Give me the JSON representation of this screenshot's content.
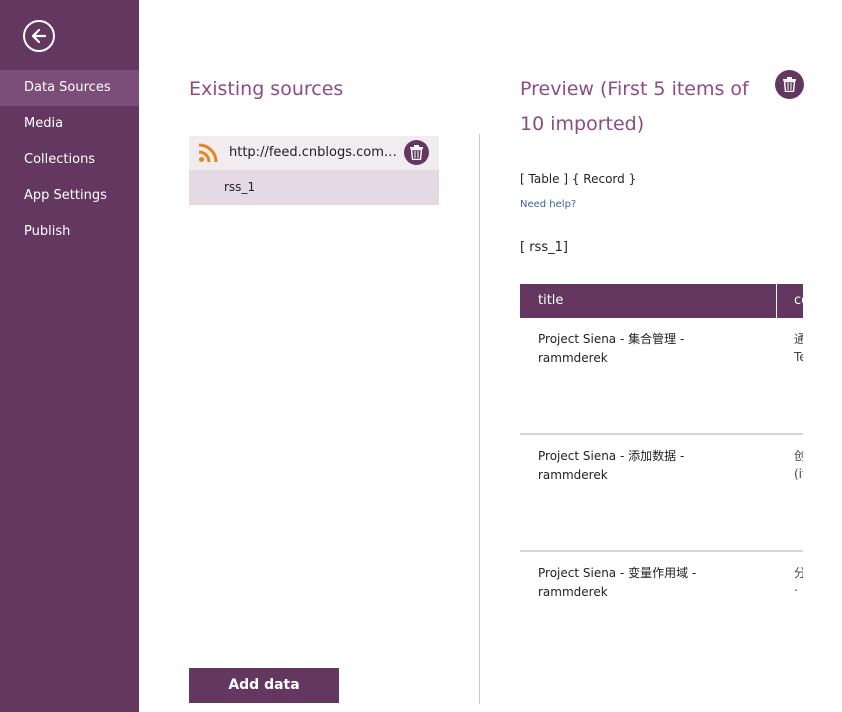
{
  "nav": {
    "items": [
      {
        "label": "Data Sources",
        "active": true
      },
      {
        "label": "Media",
        "active": false
      },
      {
        "label": "Collections",
        "active": false
      },
      {
        "label": "App Settings",
        "active": false
      },
      {
        "label": "Publish",
        "active": false
      }
    ]
  },
  "existing": {
    "title": "Existing sources",
    "source_url": "http://feed.cnblogs.com/b...",
    "source_child": "rss_1",
    "add_label": "Add data"
  },
  "preview": {
    "title": "Preview (First 5 items of 10 imported)",
    "format": "[ Table ] { Record }",
    "help": "Need help?",
    "table_name": "[ rss_1]",
    "columns": [
      "title",
      "co"
    ],
    "rows": [
      {
        "title": "Project Siena - 集合管理 - rammderek",
        "content": "通义数Te两力"
      },
      {
        "title": "Project Siena - 添加数据 - rammderek",
        "content": "创C(it(it汁("
      },
      {
        "title": "Project Siena - 变量作用域 - rammderek",
        "content": "分 可 ‧ ‧ ‧"
      }
    ]
  },
  "colors": {
    "accent": "#633760",
    "title": "#8b4c86",
    "rss": "#e8841a"
  }
}
